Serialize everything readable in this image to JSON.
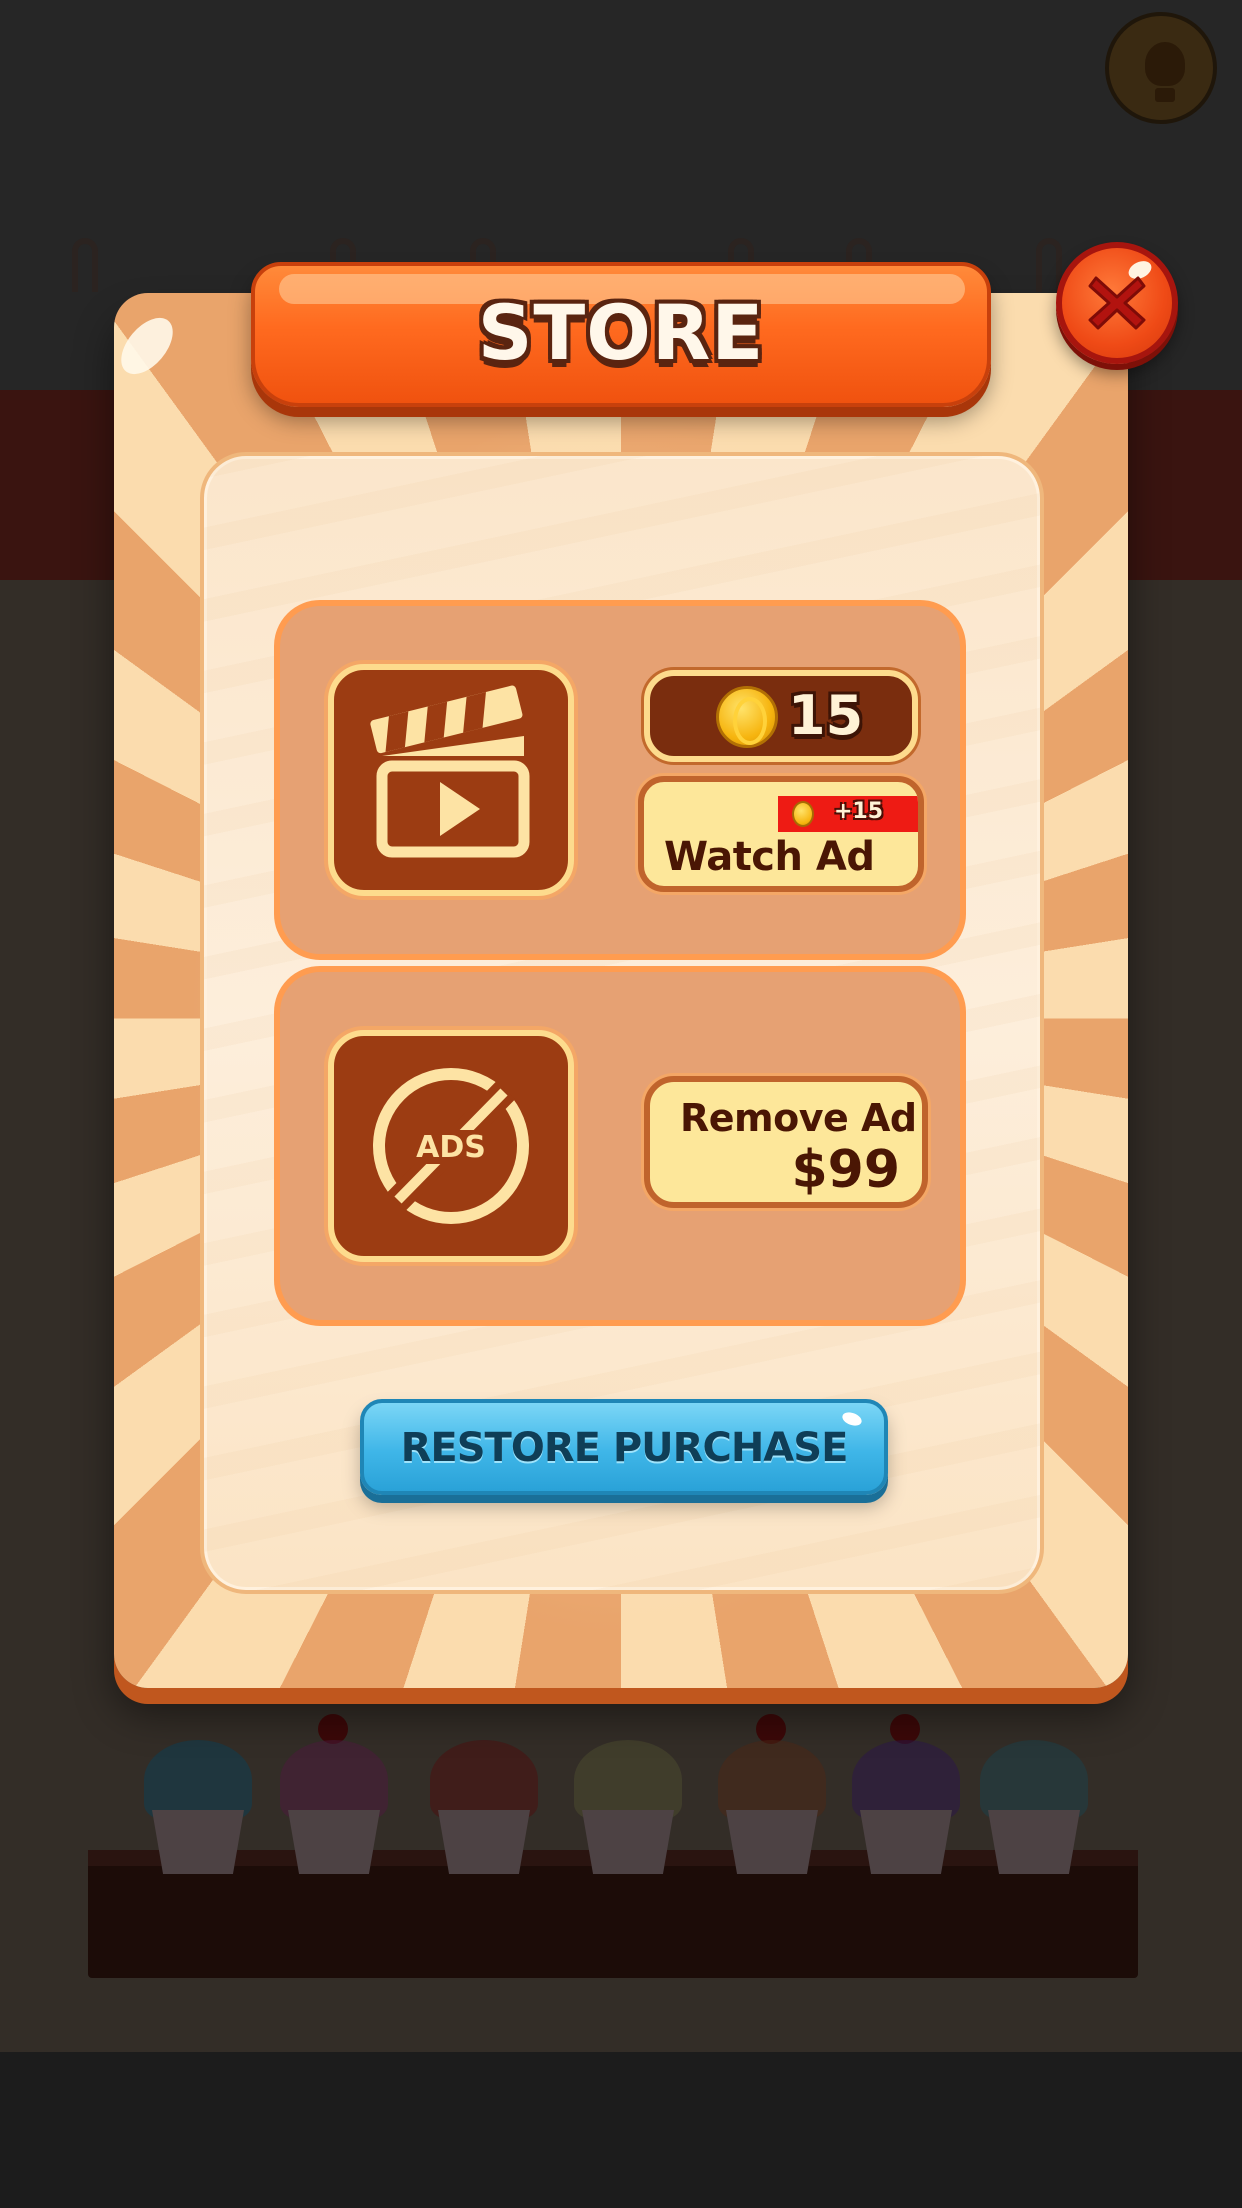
{
  "dialog": {
    "title": "STORE",
    "close_icon": "close-x-icon"
  },
  "items": [
    {
      "id": "watch_ad",
      "icon": "clapperboard-icon",
      "coin_balance": "15",
      "reward_badge": "+15",
      "button_label": "Watch Ad"
    },
    {
      "id": "remove_ad",
      "icon": "no-ads-icon",
      "icon_text": "ADS",
      "button_label": "Remove Ad",
      "price": "$99"
    }
  ],
  "restore": {
    "label": "RESTORE PURCHASE"
  },
  "background": {
    "hint_icon": "lightbulb-icon"
  },
  "colors": {
    "title_banner": "#ff6a1f",
    "close_button": "#ef4a16",
    "item_tile": "#9c3c12",
    "button_fill": "#fde79a",
    "reward_badge": "#ee1b14",
    "restore_button": "#3fb6e8"
  }
}
